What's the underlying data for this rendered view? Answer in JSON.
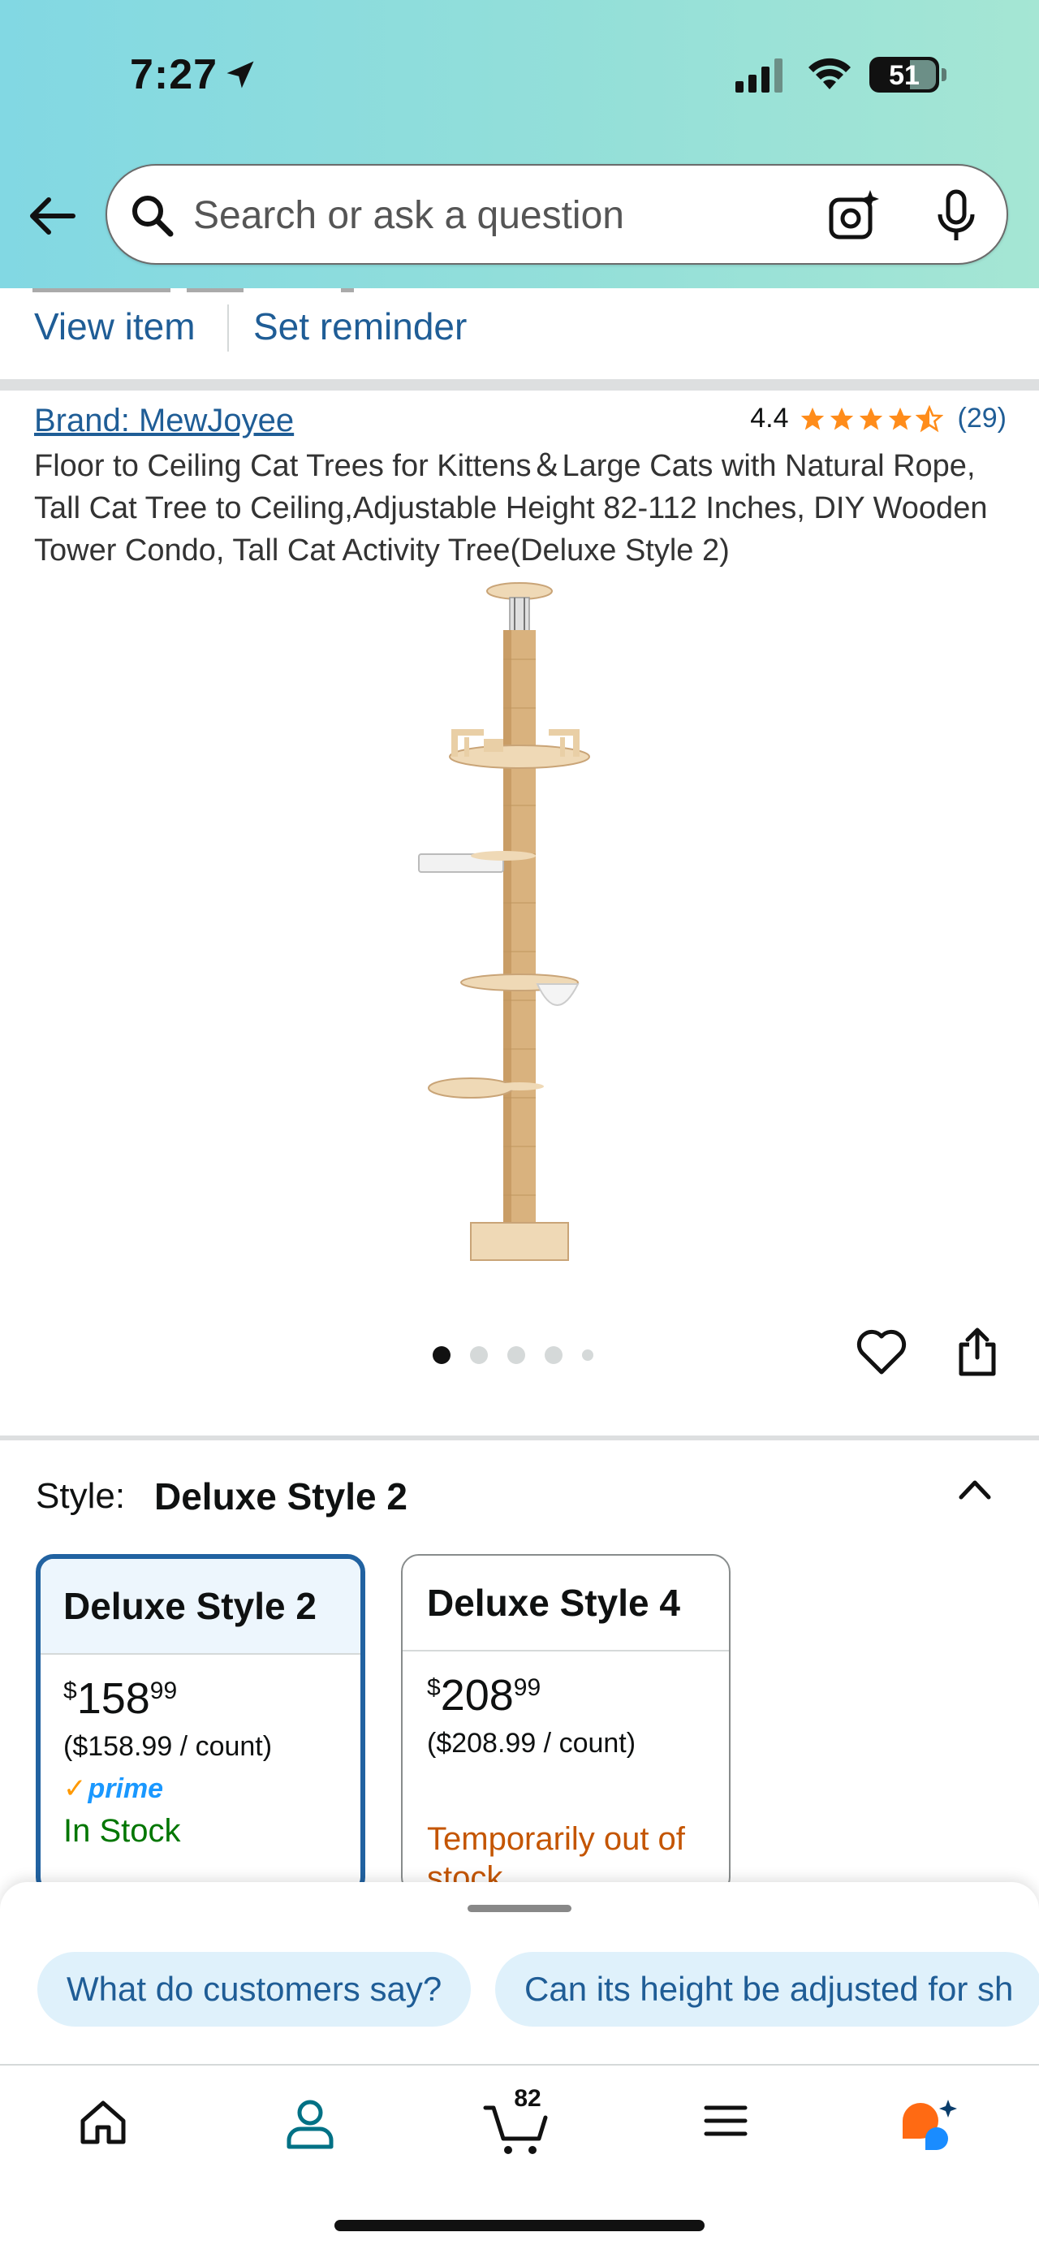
{
  "status_bar": {
    "time": "7:27",
    "battery": "51"
  },
  "search": {
    "placeholder": "Search or ask a question"
  },
  "actions": {
    "view_item": "View item",
    "set_reminder": "Set reminder"
  },
  "product": {
    "brand": "Brand: MewJoyee",
    "rating": "4.4",
    "review_count": "(29)",
    "title": "Floor to Ceiling Cat Trees for Kittens＆Large Cats with Natural Rope, Tall Cat Tree to Ceiling,Adjustable Height 82-112 Inches, DIY Wooden Tower Condo, Tall Cat Activity Tree(Deluxe Style 2)",
    "image_count": 5,
    "active_image_index": 0
  },
  "style": {
    "label": "Style:",
    "selected": "Deluxe Style 2",
    "options": [
      {
        "name": "Deluxe Style 2",
        "price_symbol": "$",
        "price_whole": "158",
        "price_fraction": "99",
        "unit_price": "($158.99 / count)",
        "prime": "prime",
        "availability": "In Stock"
      },
      {
        "name": "Deluxe Style 4",
        "price_symbol": "$",
        "price_whole": "208",
        "price_fraction": "99",
        "unit_price": "($208.99 / count)",
        "availability": "Temporarily out of stock"
      }
    ]
  },
  "suggestions": [
    "What do customers say?",
    "Can its height be adjusted for sh"
  ],
  "tabbar": {
    "cart_count": "82"
  },
  "colors": {
    "link": "#1f5d96",
    "star": "#ff8c1a",
    "in_stock": "#007600",
    "out_of_stock": "#c45500",
    "selected_border": "#2162a1",
    "prime": "#1a98ff"
  }
}
